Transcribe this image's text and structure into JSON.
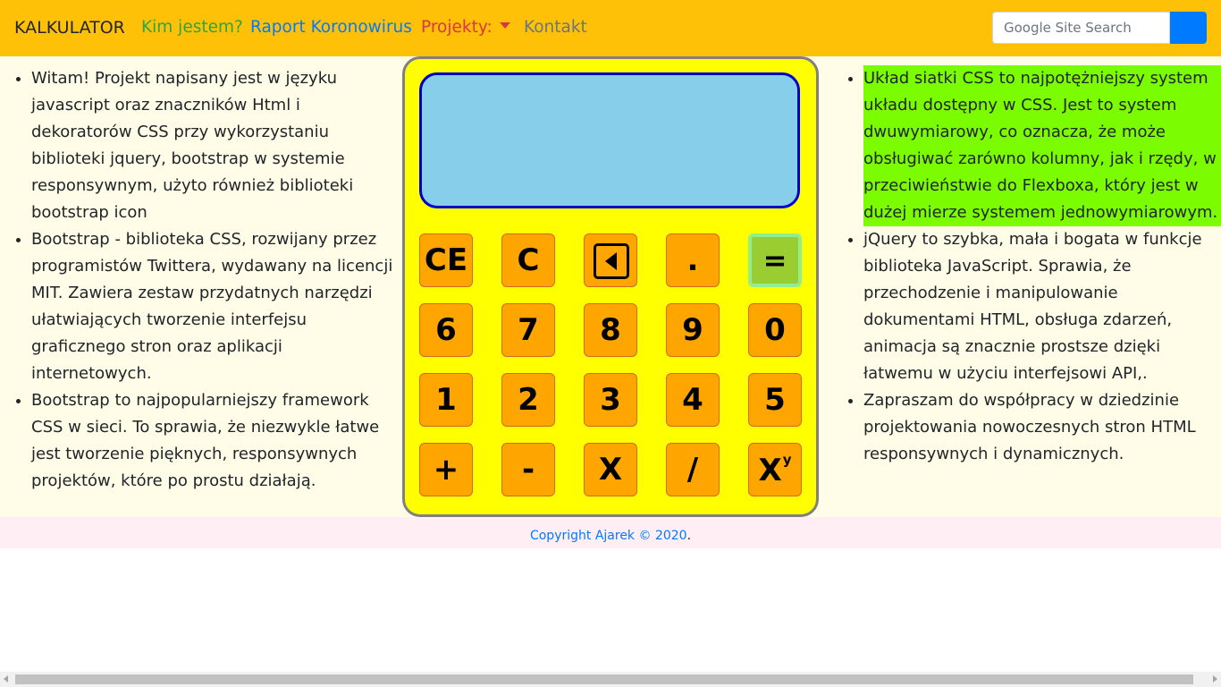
{
  "colors": {
    "navbar_bg": "#ffc107",
    "main_bg": "#fffde7",
    "calculator_bg": "#ffff00",
    "display_bg": "#87ceeb",
    "key_bg": "#ffa500",
    "equals_key_bg": "#9acd32",
    "highlight_bg": "#7cfc00",
    "footer_bg": "#ffeef3"
  },
  "navbar": {
    "brand": "KALKULATOR",
    "links": [
      {
        "label": "Kim jestem?",
        "color": "#28a745"
      },
      {
        "label": "Raport Koronowirus",
        "color": "#007bff"
      },
      {
        "label": "Projekty:",
        "color": "#dc3545",
        "icon": "caret-down-icon"
      },
      {
        "label": "Kontakt",
        "color": "#6c757d"
      }
    ],
    "search": {
      "placeholder": "Google Site Search",
      "button_icon": "search-button"
    }
  },
  "left_column": {
    "items": [
      "Witam! Projekt napisany jest w języku javascript oraz znaczników Html i dekoratorów CSS przy wykorzystaniu biblioteki jquery, bootstrap w systemie responsywnym, użyto również biblioteki bootstrap icon",
      "Bootstrap - biblioteka CSS, rozwijany przez programistów Twittera, wydawany na licencji MIT. Zawiera zestaw przydatnych narzędzi ułatwiających tworzenie interfejsu graficznego stron oraz aplikacji internetowych.",
      "Bootstrap to najpopularniejszy framework CSS w sieci. To sprawia, że niezwykle łatwe jest tworzenie pięknych, responsywnych projektów, które po prostu działają."
    ]
  },
  "right_column": {
    "items": [
      "Układ siatki CSS to najpotężniejszy system układu dostępny w CSS. Jest to system dwuwymiarowy, co oznacza, że może obsługiwać zarówno kolumny, jak i rzędy, w przeciwieństwie do Flexboxa, który jest w dużej mierze systemem jednowymiarowym.",
      "jQuery to szybka, mała i bogata w funkcje biblioteka JavaScript. Sprawia, że przechodzenie i manipulowanie dokumentami HTML, obsługa zdarzeń, animacja są znacznie prostsze dzięki łatwemu w użyciu interfejsowi API,.",
      "Zapraszam do współpracy w dziedzinie projektowania nowoczesnych stron HTML responsywnych i dynamicznych."
    ]
  },
  "calculator": {
    "display_value": "",
    "keys": {
      "ce": "CE",
      "c": "C",
      "backspace_icon": "backspace-icon",
      "dot": ".",
      "equals": "=",
      "six": "6",
      "seven": "7",
      "eight": "8",
      "nine": "9",
      "zero": "0",
      "one": "1",
      "two": "2",
      "three": "3",
      "four": "4",
      "five": "5",
      "plus": "+",
      "minus": "-",
      "multiply": "X",
      "divide": "/",
      "power_base": "X",
      "power_exp": "y"
    }
  },
  "footer": {
    "copyright": "Copyright Ajarek © 2020",
    "dot": "."
  }
}
